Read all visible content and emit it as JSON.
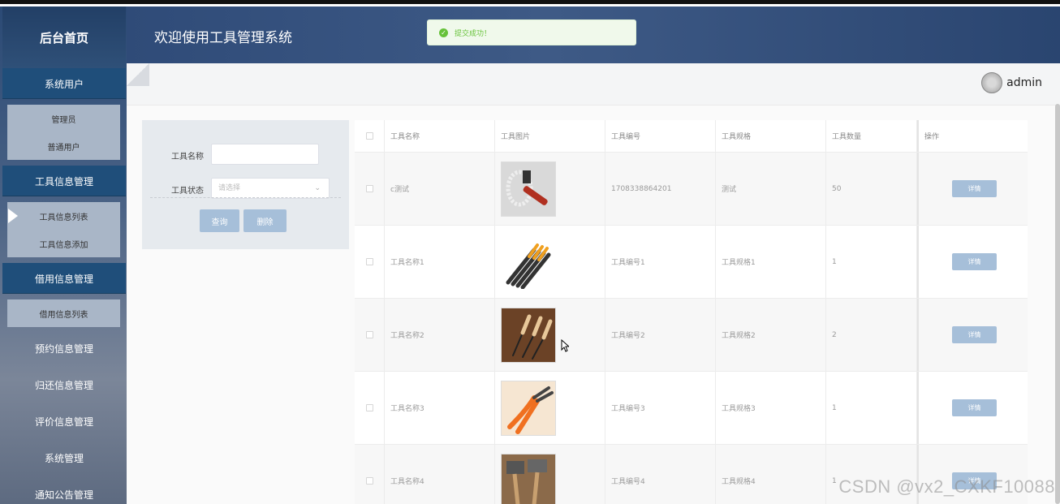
{
  "sidebar": {
    "brand": "后台首页",
    "sections": [
      {
        "label": "系统用户",
        "items": [
          "管理员",
          "普通用户"
        ]
      },
      {
        "label": "工具信息管理",
        "items": [
          "工具信息列表",
          "工具信息添加"
        ]
      },
      {
        "label": "借用信息管理",
        "items": [
          "借用信息列表"
        ]
      }
    ],
    "plain": [
      "预约信息管理",
      "归还信息管理",
      "评价信息管理",
      "系统管理",
      "通知公告管理"
    ]
  },
  "header": {
    "title": "欢迎使用工具管理系统"
  },
  "toast": {
    "icon": "check-circle-icon",
    "text": "提交成功！",
    "color": "#67c23a"
  },
  "user": {
    "name": "admin"
  },
  "search": {
    "name_label": "工具名称",
    "status_label": "工具状态",
    "status_placeholder": "请选择",
    "query_button": "查询",
    "delete_button": "删除"
  },
  "table": {
    "headers": [
      "工具名称",
      "工具图片",
      "工具编号",
      "工具规格",
      "工具数量",
      "操作"
    ],
    "rows": [
      {
        "name": "c测试",
        "image": "wrench-image",
        "code": "1708338864201",
        "spec": "测试",
        "qty": "50",
        "action": "详情"
      },
      {
        "name": "工具名称1",
        "image": "screwdriver-image",
        "code": "工具编号1",
        "spec": "工具规格1",
        "qty": "1",
        "action": "详情"
      },
      {
        "name": "工具名称2",
        "image": "chisel-image",
        "code": "工具编号2",
        "spec": "工具规格2",
        "qty": "2",
        "action": "详情"
      },
      {
        "name": "工具名称3",
        "image": "pliers-image",
        "code": "工具编号3",
        "spec": "工具规格3",
        "qty": "1",
        "action": "详情"
      },
      {
        "name": "工具名称4",
        "image": "axe-image",
        "code": "工具编号4",
        "spec": "工具规格4",
        "qty": "1",
        "action": "详情"
      }
    ]
  },
  "watermark": "CSDN @vx2_CXKF10088",
  "colors": {
    "accent": "#1f4e7a",
    "button": "#a6bfd9"
  }
}
